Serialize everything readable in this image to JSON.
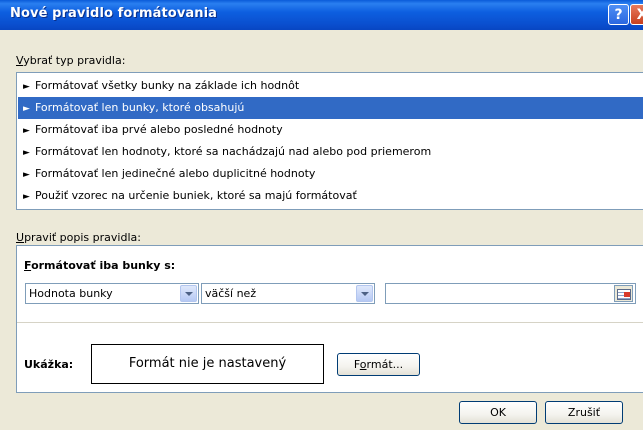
{
  "window": {
    "title": "Nové pravidlo formátovania",
    "help_label": "?",
    "close_label": "X"
  },
  "rule_type": {
    "label_accel": "V",
    "label_rest": "ybrať typ pravidla:",
    "arrow": "►",
    "items": [
      {
        "label": "Formátovať všetky bunky na základe ich hodnôt",
        "selected": false
      },
      {
        "label": "Formátovať len bunky, ktoré obsahujú",
        "selected": true
      },
      {
        "label": "Formátovať iba prvé alebo posledné hodnoty",
        "selected": false
      },
      {
        "label": "Formátovať len hodnoty, ktoré sa nachádzajú nad alebo pod priemerom",
        "selected": false
      },
      {
        "label": "Formátovať len jedinečné alebo duplicitné hodnoty",
        "selected": false
      },
      {
        "label": "Použiť vzorec na určenie buniek, ktoré sa majú formátovať",
        "selected": false
      }
    ]
  },
  "edit_description": {
    "label_accel": "U",
    "label_rest": "praviť popis pravidla:",
    "heading_accel": "F",
    "heading_rest": "ormátovať iba bunky s:",
    "field_combo_value": "Hodnota bunky",
    "operator_combo_value": "väčší než",
    "value_input": "",
    "preview_label": "Ukážka:",
    "preview_text": "Formát nie je nastavený",
    "format_button_pre": "F",
    "format_button_accel": "o",
    "format_button_post": "rmát..."
  },
  "buttons": {
    "ok": "OK",
    "cancel": "Zrušiť"
  },
  "colors": {
    "titlebar": "#0a4fcf",
    "selection": "#316ac5",
    "dialog_bg": "#ece9d8"
  }
}
